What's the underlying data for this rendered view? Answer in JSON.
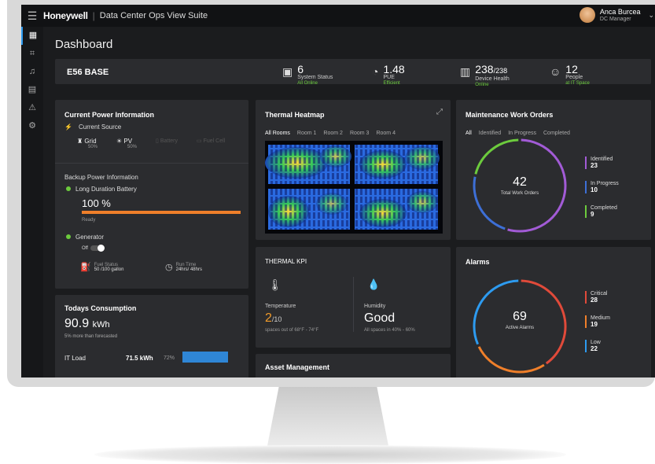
{
  "header": {
    "brand": "Honeywell",
    "app": "Data Center Ops View Suite",
    "user_name": "Anca Burcea",
    "user_role": "DC Manager"
  },
  "page_title": "Dashboard",
  "summary": {
    "site": "E56 BASE",
    "system_status": {
      "value": "6",
      "label": "System Status",
      "sub": "All Online"
    },
    "pue": {
      "value": "1.48",
      "label": "PUE",
      "sub": "Efficient"
    },
    "device_health": {
      "value": "238",
      "total": "/238",
      "label": "Device Health",
      "sub": "Online"
    },
    "people": {
      "value": "12",
      "label": "People",
      "sub": "at IT Space"
    }
  },
  "power": {
    "title": "Current Power Information",
    "current_source": "Current Source",
    "sources": [
      {
        "name": "Grid",
        "pct": "50%"
      },
      {
        "name": "PV",
        "pct": "50%"
      },
      {
        "name": "Battery",
        "pct": ""
      },
      {
        "name": "Fuel Cell",
        "pct": ""
      }
    ],
    "backup_title": "Backup Power Information",
    "battery_label": "Long Duration Battery",
    "battery_value": "100 %",
    "battery_fill": 1.0,
    "battery_status": "Ready",
    "generator_label": "Generator",
    "generator_state": "Off",
    "fuel_label": "Fuel Status",
    "fuel_value": "50 /100 gallon",
    "runtime_label": "Run Time",
    "runtime_value": "24hrs/ 48hrs"
  },
  "consumption": {
    "title": "Todays Consumption",
    "value": "90.9",
    "unit": "kWh",
    "note": "5% more than forecasted",
    "row_label": "IT Load",
    "row_value": "71.5 kWh",
    "row_pct": "72%",
    "row_fill": 0.72
  },
  "thermal": {
    "title": "Thermal Heatmap",
    "tabs": [
      "All Rooms",
      "Room 1",
      "Room 2",
      "Room 3",
      "Room 4"
    ]
  },
  "kpi": {
    "title": "THERMAL KPI",
    "temp_label": "Temperature",
    "temp_value": "2",
    "temp_total": "/10",
    "temp_note": "spaces out of 68°F - 74°F",
    "hum_label": "Humidity",
    "hum_value": "Good",
    "hum_note": "All spaces in 40% - 60%"
  },
  "asset": {
    "title": "Asset Management"
  },
  "workorders": {
    "title": "Maintenance Work Orders",
    "tabs": [
      "All",
      "Identified",
      "In Progress",
      "Completed"
    ],
    "total": "42",
    "total_label": "Total Work Orders",
    "items": [
      {
        "label": "Identified",
        "value": "23",
        "color": "#a25bd6"
      },
      {
        "label": "In Progress",
        "value": "10",
        "color": "#3d6fd6"
      },
      {
        "label": "Completed",
        "value": "9",
        "color": "#6ccb3d"
      }
    ]
  },
  "alarms": {
    "title": "Alarms",
    "total": "69",
    "total_label": "Active Alarms",
    "items": [
      {
        "label": "Critical",
        "value": "28",
        "color": "#e04a3a"
      },
      {
        "label": "Medium",
        "value": "19",
        "color": "#ef7f2a"
      },
      {
        "label": "Low",
        "value": "22",
        "color": "#2d9bf0"
      }
    ]
  }
}
